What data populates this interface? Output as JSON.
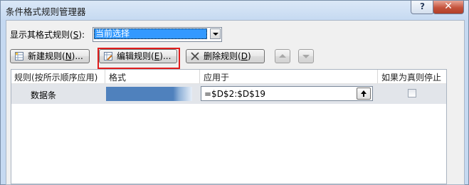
{
  "window": {
    "title": "条件格式规则管理器",
    "help_label": "?",
    "close_label": "✕"
  },
  "show_rules": {
    "label_pre": "显示其格式规则(",
    "label_key": "S",
    "label_post": "):",
    "selected": "当前选择"
  },
  "toolbar": {
    "new_rule": {
      "pre": "新建规则(",
      "key": "N",
      "post": ")..."
    },
    "edit_rule": {
      "pre": "编辑规则(",
      "key": "E",
      "post": ")..."
    },
    "delete_rule": {
      "pre": "删除规则(",
      "key": "D",
      "post": ")"
    }
  },
  "table": {
    "headers": {
      "rule": "规则(按所示顺序应用)",
      "format": "格式",
      "applies_to": "应用于",
      "stop_if_true": "如果为真则停止"
    },
    "rows": [
      {
        "rule": "数据条",
        "format_color": "#4f81bd",
        "applies_to": "=$D$2:$D$19",
        "stop_if_true": false
      }
    ]
  },
  "colors": {
    "highlight": "#e01e1e",
    "selection": "#3399ff"
  }
}
